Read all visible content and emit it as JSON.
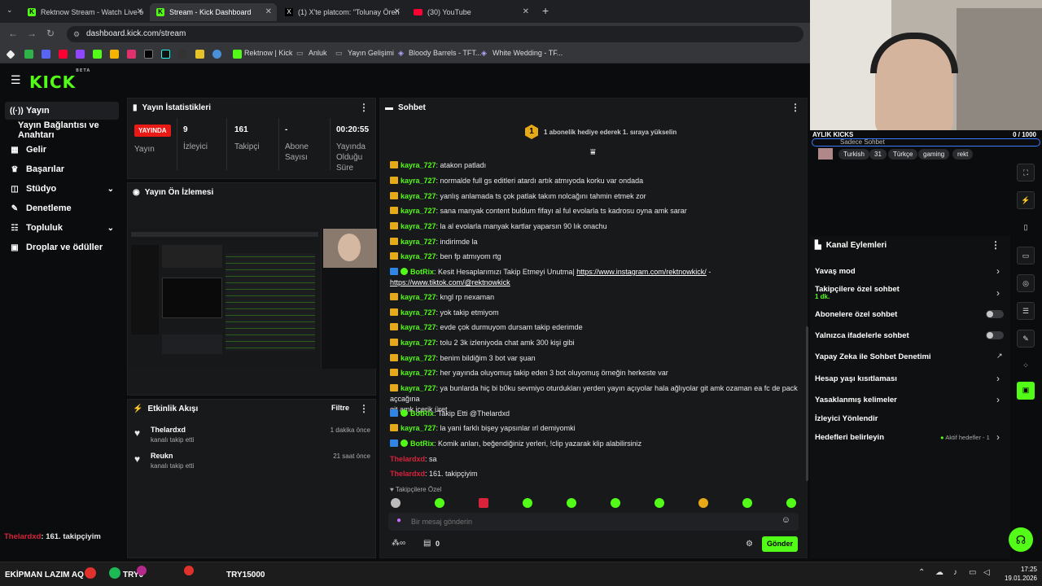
{
  "browser": {
    "tabs": [
      {
        "title": "Rektnow Stream - Watch Live o",
        "active": false
      },
      {
        "title": "Stream - Kick Dashboard",
        "active": true
      },
      {
        "title": "(1) X'te platcom: \"Tolunay Ören",
        "active": false
      },
      {
        "title": "(30) YouTube",
        "active": false
      }
    ],
    "new_tab": "+",
    "url": "dashboard.kick.com/stream",
    "bookmarks": [
      "Rektnow | Kick",
      "Anluk",
      "Yayın Gelişimi",
      "Bloody Barrels - TFT...",
      "White Wedding - TF..."
    ]
  },
  "kick": {
    "logo": "KICK",
    "logo_sup": "BETA",
    "sidebar": [
      {
        "label": "Yayın",
        "icon": "broadcast-icon",
        "glyph": "((·))"
      },
      {
        "label": "Yayın Bağlantısı ve Anahtarı",
        "icon": "",
        "glyph": ""
      },
      {
        "label": "Gelir",
        "icon": "revenue-icon",
        "glyph": "▦"
      },
      {
        "label": "Başarılar",
        "icon": "trophy-icon",
        "glyph": "🏆"
      },
      {
        "label": "Stüdyo",
        "icon": "studio-icon",
        "glyph": "◫"
      },
      {
        "label": "Denetleme",
        "icon": "moderation-icon",
        "glyph": "✎"
      },
      {
        "label": "Topluluk",
        "icon": "community-icon",
        "glyph": "👥"
      },
      {
        "label": "Droplar ve ödüller",
        "icon": "gift-icon",
        "glyph": "🎁"
      }
    ],
    "sidebar_chevron": "⌄",
    "stats": {
      "title": "Yayın İstatistikleri",
      "live_label": "YAYINDA",
      "stream_label": "Yayın",
      "items": [
        {
          "value": "9",
          "label": "İzleyici"
        },
        {
          "value": "161",
          "label": "Takipçi"
        },
        {
          "value": "-",
          "label": "Abone Sayısı"
        },
        {
          "value": "00:20:55",
          "label": "Yayında Olduğu Süre"
        }
      ]
    },
    "preview": {
      "title": "Yayın Ön İzlemesi"
    },
    "activity": {
      "title": "Etkinlik Akışı",
      "filter": "Filtre",
      "items": [
        {
          "user": "Thelardxd",
          "action": "kanalı takip etti",
          "time": "1 dakika önce"
        },
        {
          "user": "Reukn",
          "action": "kanalı takip etti",
          "time": "21 saat önce"
        }
      ]
    },
    "chat": {
      "title": "Sohbet",
      "goal_count": "1",
      "goal_text": "1 abonelik hediye ederek 1. sıraya yükselin",
      "messages": [
        {
          "user": "kayra_727",
          "text": ": atakon patladı",
          "bot": false
        },
        {
          "user": "kayra_727",
          "text": ": normalde full gs editleri atardı artık atmıyoda korku var ondada",
          "bot": false
        },
        {
          "user": "kayra_727",
          "text": ": yanlış anlamada ts çok patlak takım nolcağını tahmin etmek zor",
          "bot": false
        },
        {
          "user": "kayra_727",
          "text": ": sana manyak content buldum fifayı al ful evolarla ts kadrosu oyna amk sarar",
          "bot": false
        },
        {
          "user": "kayra_727",
          "text": ": la al evolarla manyak kartlar yaparsın 90 lık onachu",
          "bot": false
        },
        {
          "user": "kayra_727",
          "text": ": indirimde la",
          "bot": false
        },
        {
          "user": "kayra_727",
          "text": ": ben fp atmıyom rtg",
          "bot": false
        },
        {
          "user": "kayra_727",
          "text": ": kngl rp nexaman",
          "bot": false
        },
        {
          "user": "kayra_727",
          "text": ": yok takip etmiyom",
          "bot": false
        },
        {
          "user": "kayra_727",
          "text": ": evde çok durmuyom dursam takip ederimde",
          "bot": false
        },
        {
          "user": "kayra_727",
          "text": ": tolu 2 3k izleniyoda chat amk 300 kişi gibi",
          "bot": false
        },
        {
          "user": "kayra_727",
          "text": ": benim bildiğim 3 bot var şuan",
          "bot": false
        },
        {
          "user": "kayra_727",
          "text": ": her yayında oluyomuş takip eden 3 bot oluyomuş örneğin herkeste var",
          "bot": false
        },
        {
          "user": "kayra_727",
          "text": ": ya bunlarda hiç bi b0ku sevmiyo oturdukları yerden yayın açıyolar hala ağlıyolar git amk ozaman ea fc de pack açcağına",
          "cont": "git amk içerik üret",
          "bot": false
        },
        {
          "user": "BotRix",
          "text": ": Takip Etti @Thelardxd",
          "bot": true
        },
        {
          "user": "kayra_727",
          "text": ": la yani farklı bişey yapsınlar ırl demiyomki",
          "bot": false
        },
        {
          "user": "BotRix",
          "text": ": Komik anları, beğendiğiniz yerleri, !clip yazarak klip alabilirsiniz",
          "bot": true
        },
        {
          "user": "Thelardxd",
          "text": ": sa",
          "bot": false
        },
        {
          "user": "Thelardxd",
          "text": ": 161. takipçiyim",
          "bot": false
        }
      ],
      "botrix_promo": {
        "user": "BotRix",
        "text": ": Kesit Hesaplarımızı Takip Etmeyi Unutma|",
        "link1": "https://www.instagram.com/rektnowkick/",
        "sep": " -",
        "link2": "https://www.tiktok.com/@rektnowkick"
      },
      "follower_only": "Takipçilere Özel",
      "input_placeholder": "Bir mesaj gönderin",
      "points": "0",
      "send": "Gönder"
    },
    "channel_actions": {
      "overlay_title": "AYLIK KICKS",
      "overlay_value": "0 / 1000",
      "chat_mode": "Sadece Sohbet",
      "tags": [
        "Turkish",
        "31",
        "Türkçe",
        "gaming",
        "rekt"
      ],
      "title": "Kanal Eylemleri",
      "rows": [
        {
          "label": "Yavaş mod",
          "sub": "",
          "type": "chevron"
        },
        {
          "label": "Takipçilere özel sohbet",
          "sub": "1 dk.",
          "type": "chevron"
        },
        {
          "label": "Abonelere özel sohbet",
          "sub": "",
          "type": "toggle"
        },
        {
          "label": "Yalnızca ifadelerle sohbet",
          "sub": "",
          "type": "toggle"
        },
        {
          "label": "Yapay Zeka ile Sohbet Denetimi",
          "sub": "",
          "type": "external"
        },
        {
          "label": "Hesap yaşı kısıtlaması",
          "sub": "",
          "type": "chevron"
        },
        {
          "label": "Yasaklanmış kelimeler",
          "sub": "",
          "type": "chevron"
        },
        {
          "label": "İzleyici Yönlendir",
          "sub": "",
          "type": "none"
        },
        {
          "label": "Hedefleri belirleyin",
          "sub": "",
          "type": "chevron"
        }
      ],
      "goals_status": "Aktif hedefler - 1"
    },
    "overlay_chat": {
      "user": "Thelardxd",
      "text": ": 161. takipçiyim"
    }
  },
  "taskbar": {
    "left": "EKİPMAN LAZIM AQ",
    "try1": "TRY0",
    "try2": "TRY15000",
    "time": "17:25",
    "date": "19.01.2026"
  },
  "colors": {
    "accent": "#53fc18",
    "live": "#e91916",
    "bg": "#0b0c0d",
    "panel": "#18191b"
  }
}
